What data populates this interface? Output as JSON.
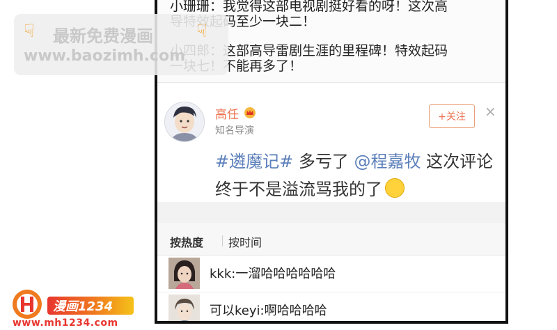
{
  "previous_comments": {
    "line1": "小珊珊：我觉得这部电视剧挺好看的呀！这次高",
    "line2": "导特效起码至少一块二！",
    "line3": "小四郎：这部高导雷剧生涯的里程碑！特效起码",
    "line4": "一块七！不能再多了！"
  },
  "watermark": {
    "line1": "最新免费漫画",
    "line2": "www.baozimh.com"
  },
  "post": {
    "author_name": "高任",
    "author_description": "知名导演",
    "follow_label": "+关注",
    "close_symbol": "×",
    "hashtag": "#遴魔记#",
    "text_part1": " 多亏了 ",
    "mention": "@程嘉牧",
    "text_part2": " 这次评论",
    "text_line2": "终于不是溢流骂我的了"
  },
  "sort_bar": {
    "by_heat": "按热度",
    "by_time": "按时间"
  },
  "comments": [
    {
      "text": "kkk:一溜哈哈哈哈哈哈"
    },
    {
      "text": "可以keyi:啊哈哈哈哈"
    }
  ],
  "site_logo": {
    "banner": "漫画1234",
    "url": "www.mh1234.com"
  },
  "colors": {
    "username": "#eb7350",
    "link": "#5b7fba",
    "frame": "#111111"
  }
}
